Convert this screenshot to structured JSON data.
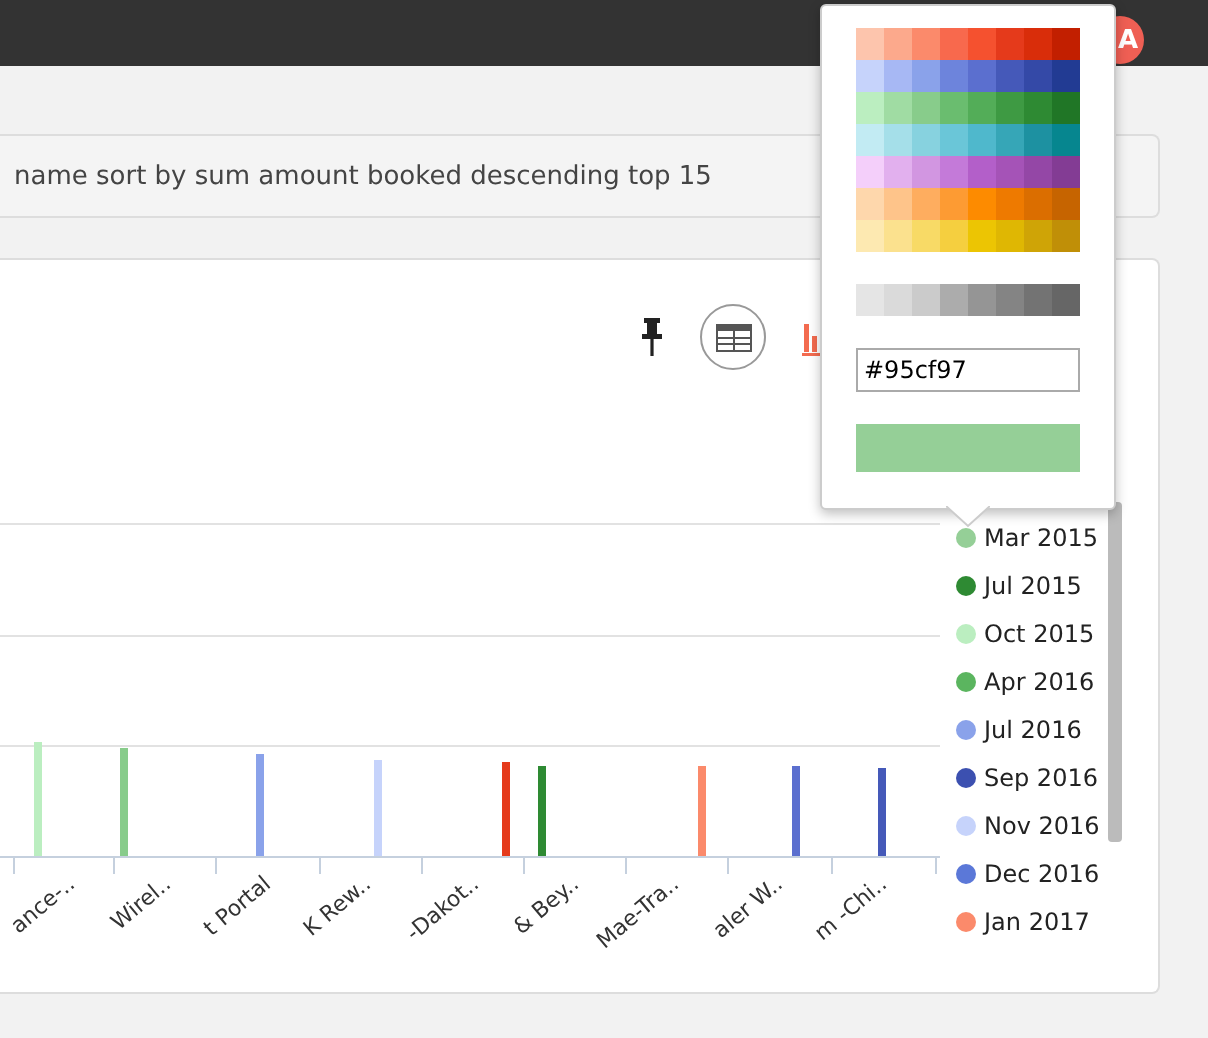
{
  "header": {
    "avatar": "A"
  },
  "query": {
    "text": "name sort by sum amount booked descending top 15"
  },
  "chart": {
    "x_labels": [
      "ance-..",
      "Wirel..",
      "t Portal",
      "K Rew..",
      "-Dakot..",
      "& Bey..",
      "Mae-Tra..",
      "aler W..",
      "m -Chi.."
    ],
    "bars": [
      {
        "color": "#bbeec0"
      },
      {
        "color": "#88cc8b"
      },
      {
        "color": "#8aa2ea"
      },
      {
        "color": "#c6d3fb"
      },
      {
        "color": "#e53a1b"
      },
      {
        "color": "#2e8a33"
      },
      {
        "color": "#fb8a6b"
      },
      {
        "color": "#5b6fcf"
      },
      {
        "color": "#4559b9"
      }
    ]
  },
  "legend": [
    {
      "label": "Mar 2015",
      "color": "#95cf97"
    },
    {
      "label": "Jul 2015",
      "color": "#2e8a33"
    },
    {
      "label": "Oct 2015",
      "color": "#bbeec0"
    },
    {
      "label": "Apr 2016",
      "color": "#5bb55f"
    },
    {
      "label": "Jul 2016",
      "color": "#8aa2ea"
    },
    {
      "label": "Sep 2016",
      "color": "#3c50b0"
    },
    {
      "label": "Nov 2016",
      "color": "#c6d3fb"
    },
    {
      "label": "Dec 2016",
      "color": "#5b78d8"
    },
    {
      "label": "Jan 2017",
      "color": "#fb8a6b"
    }
  ],
  "color_picker": {
    "palette": [
      [
        {
          "color": "#fdc5ad"
        },
        {
          "color": "#fca98c"
        },
        {
          "color": "#fb8a6b"
        },
        {
          "color": "#f8694d"
        },
        {
          "color": "#f5512f"
        },
        {
          "color": "#e53a1b"
        },
        {
          "color": "#d92d0a"
        },
        {
          "color": "#c21f00"
        }
      ],
      [
        {
          "color": "#c6d3fb"
        },
        {
          "color": "#a7b8f4"
        },
        {
          "color": "#8aa2ea"
        },
        {
          "color": "#6d84dc"
        },
        {
          "color": "#5b6fcf"
        },
        {
          "color": "#4559b9"
        },
        {
          "color": "#3449a7"
        },
        {
          "color": "#223b93"
        }
      ],
      [
        {
          "color": "#bbeec0"
        },
        {
          "color": "#a0dca3"
        },
        {
          "color": "#88cc8b"
        },
        {
          "color": "#6abd6f"
        },
        {
          "color": "#53ad58"
        },
        {
          "color": "#3e9a43"
        },
        {
          "color": "#2e8a33"
        },
        {
          "color": "#207626"
        }
      ],
      [
        {
          "color": "#c2ebf3"
        },
        {
          "color": "#a5dfe9"
        },
        {
          "color": "#87d2df"
        },
        {
          "color": "#6ac6d8"
        },
        {
          "color": "#4fb8cc"
        },
        {
          "color": "#36a6b7"
        },
        {
          "color": "#1d91a1"
        },
        {
          "color": "#06868f"
        }
      ],
      [
        {
          "color": "#f4cffa"
        },
        {
          "color": "#e2b0ee"
        },
        {
          "color": "#d296e1"
        },
        {
          "color": "#c47ad9"
        },
        {
          "color": "#b35fc9"
        },
        {
          "color": "#a553b7"
        },
        {
          "color": "#9447a6"
        },
        {
          "color": "#833c94"
        }
      ],
      [
        {
          "color": "#fed7ac"
        },
        {
          "color": "#fec48a"
        },
        {
          "color": "#fead5f"
        },
        {
          "color": "#fd9b33"
        },
        {
          "color": "#fd8b00"
        },
        {
          "color": "#ee7a00"
        },
        {
          "color": "#db6e00"
        },
        {
          "color": "#c66400"
        }
      ],
      [
        {
          "color": "#fde9b1"
        },
        {
          "color": "#fbe18e"
        },
        {
          "color": "#f8da66"
        },
        {
          "color": "#f5cf3f"
        },
        {
          "color": "#ecc503"
        },
        {
          "color": "#dfb703"
        },
        {
          "color": "#cfa406"
        },
        {
          "color": "#c08f07"
        }
      ]
    ],
    "grays": [
      {
        "color": "#e5e5e5"
      },
      {
        "color": "#dadada"
      },
      {
        "color": "#cbcbcb"
      },
      {
        "color": "#acacac"
      },
      {
        "color": "#959595"
      },
      {
        "color": "#848484"
      },
      {
        "color": "#737373"
      },
      {
        "color": "#666666"
      }
    ],
    "value": "#95cf97"
  }
}
